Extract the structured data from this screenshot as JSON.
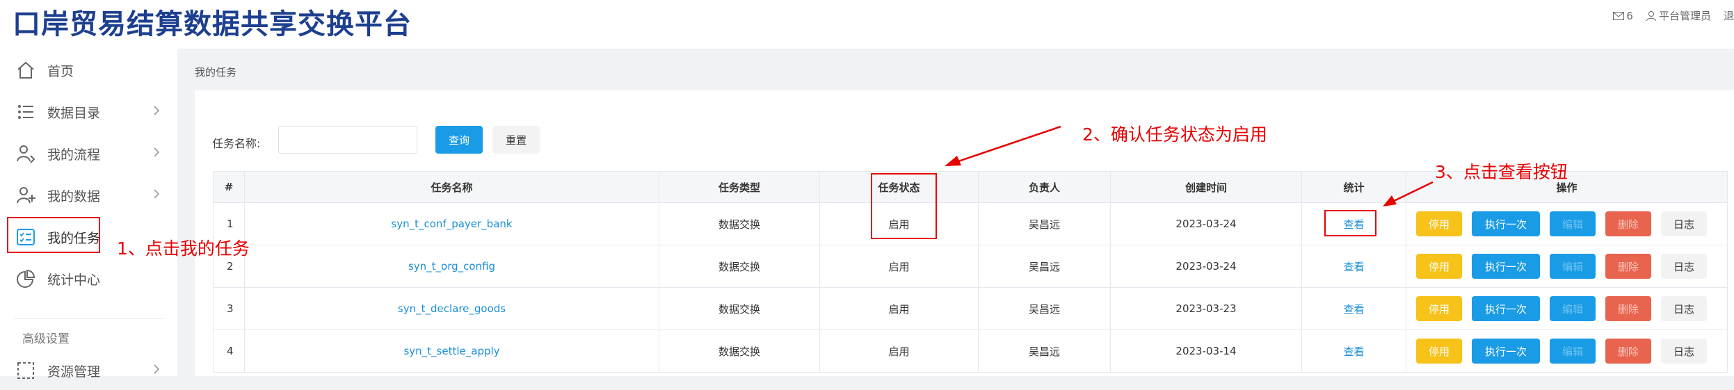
{
  "header": {
    "title": "口岸贸易结算数据共享交换平台",
    "message_count": "6",
    "user": "平台管理员",
    "logout": "退"
  },
  "sidebar": {
    "items": [
      {
        "label": "首页",
        "icon": "home-icon"
      },
      {
        "label": "数据目录",
        "icon": "list-icon"
      },
      {
        "label": "我的流程",
        "icon": "user-flow-icon"
      },
      {
        "label": "我的数据",
        "icon": "user-add-icon"
      },
      {
        "label": "我的任务",
        "icon": "task-icon"
      },
      {
        "label": "统计中心",
        "icon": "pie-chart-icon"
      }
    ],
    "section_title": "高级设置",
    "section_items": [
      {
        "label": "资源管理",
        "icon": "resource-icon"
      }
    ]
  },
  "breadcrumb": "我的任务",
  "search": {
    "label": "任务名称:",
    "value": "",
    "query_label": "查询",
    "reset_label": "重置"
  },
  "table": {
    "columns": [
      "#",
      "任务名称",
      "任务类型",
      "任务状态",
      "负责人",
      "创建时间",
      "统计",
      "操作"
    ],
    "rows": [
      {
        "idx": "1",
        "name": "syn_t_conf_payer_bank",
        "type": "数据交换",
        "status": "启用",
        "owner": "吴昌远",
        "created": "2023-03-24",
        "stat": "查看"
      },
      {
        "idx": "2",
        "name": "syn_t_org_config",
        "type": "数据交换",
        "status": "启用",
        "owner": "吴昌远",
        "created": "2023-03-24",
        "stat": "查看"
      },
      {
        "idx": "3",
        "name": "syn_t_declare_goods",
        "type": "数据交换",
        "status": "启用",
        "owner": "吴昌远",
        "created": "2023-03-23",
        "stat": "查看"
      },
      {
        "idx": "4",
        "name": "syn_t_settle_apply",
        "type": "数据交换",
        "status": "启用",
        "owner": "吴昌远",
        "created": "2023-03-14",
        "stat": "查看"
      }
    ],
    "actions": [
      "停用",
      "执行一次",
      "编辑",
      "删除",
      "日志"
    ]
  },
  "annotations": {
    "step1": "1、点击我的任务",
    "step2": "2、确认任务状态为启用",
    "step3": "3、点击查看按钮",
    "color": "#e60000"
  },
  "colors": {
    "brand": "#1d3f8f",
    "primary": "#1a9be6",
    "warning": "#f7c21a",
    "danger": "#e8644f",
    "link": "#1a8fd8"
  }
}
